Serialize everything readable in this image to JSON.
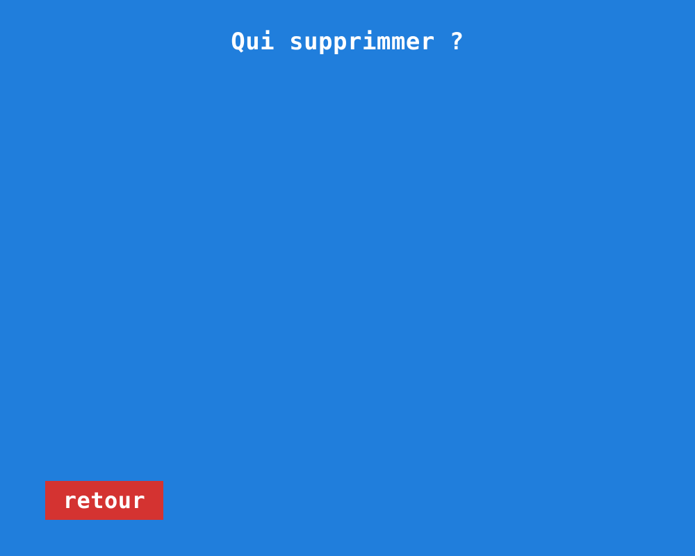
{
  "screen": {
    "title": "Qui supprimmer ?",
    "back_label": "retour"
  },
  "colors": {
    "background": "#207edc",
    "back_button": "#d43331",
    "text": "#ffffff"
  }
}
